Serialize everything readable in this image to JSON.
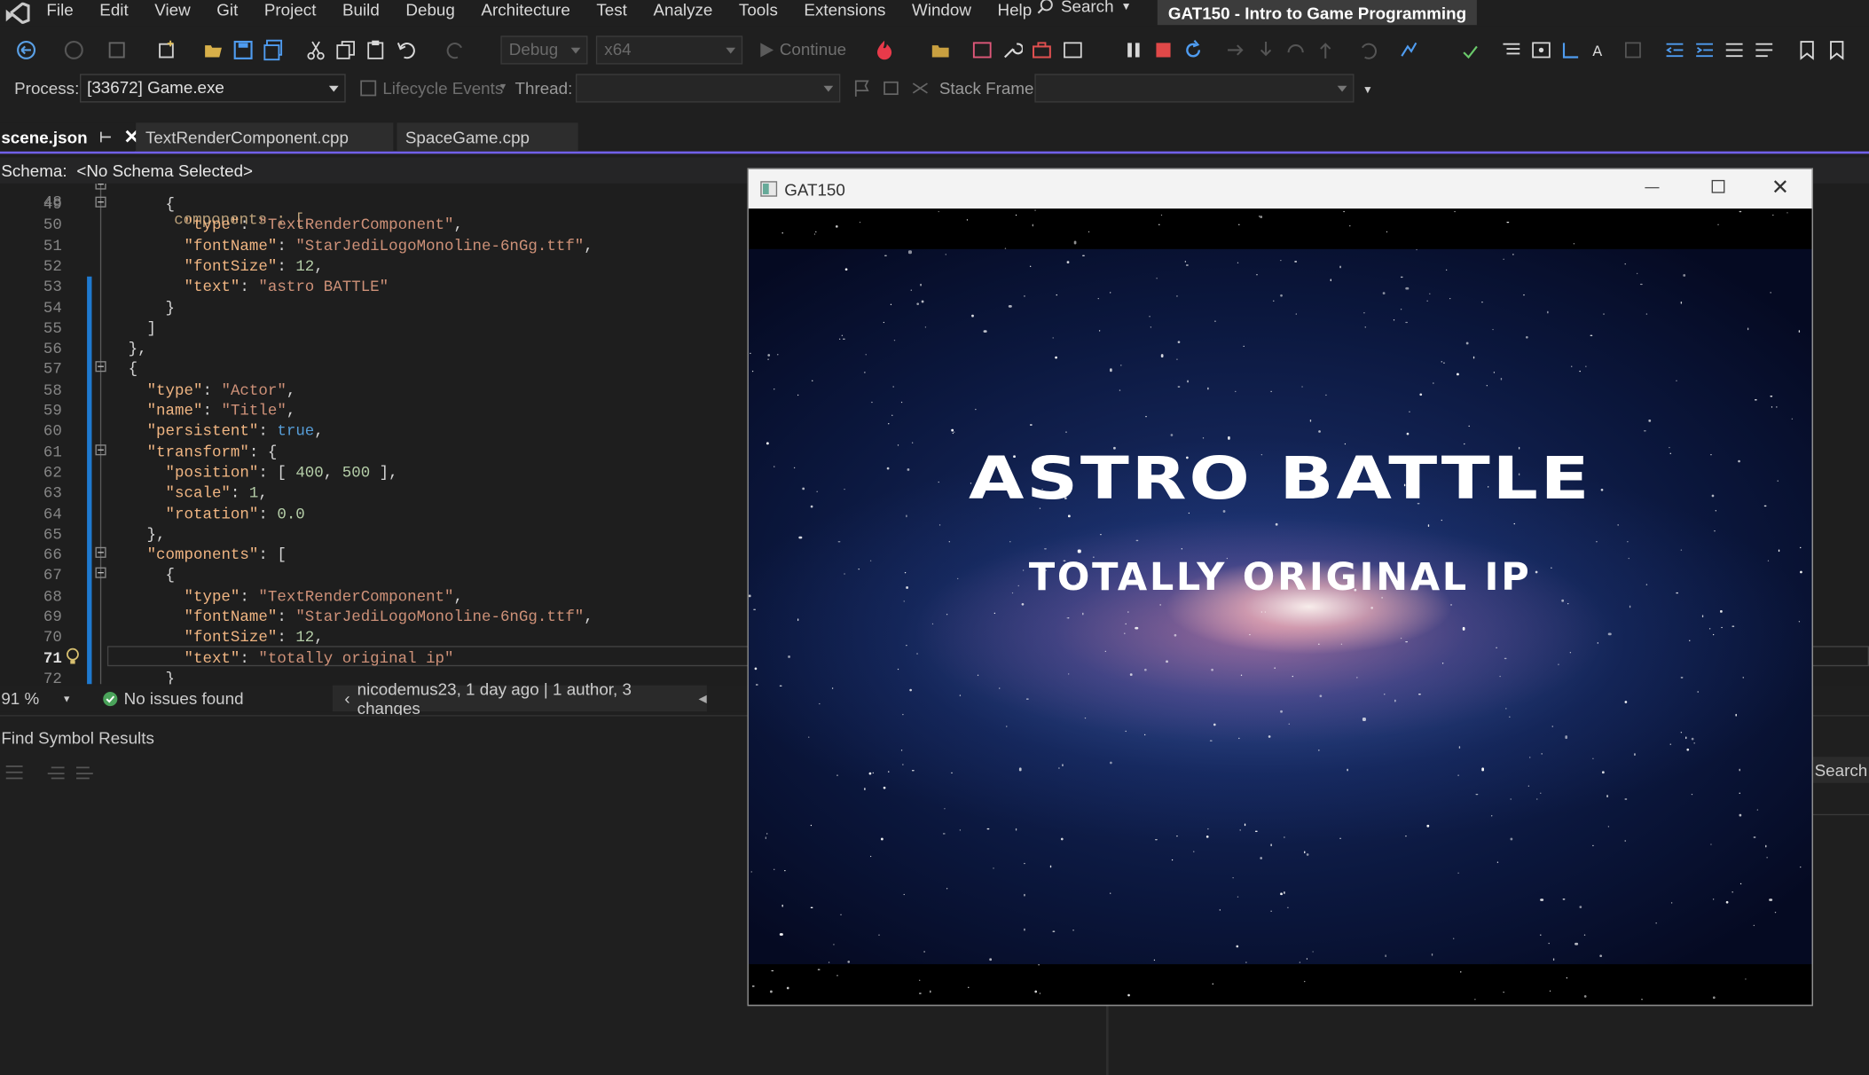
{
  "menu": {
    "items": [
      "File",
      "Edit",
      "View",
      "Git",
      "Project",
      "Build",
      "Debug",
      "Architecture",
      "Test",
      "Analyze",
      "Tools",
      "Extensions",
      "Window",
      "Help"
    ],
    "search_label": "Search",
    "solution_title": "GAT150 - Intro to Game Programming"
  },
  "toolbar": {
    "config": "Debug",
    "platform": "x64",
    "continue_label": "Continue"
  },
  "debug_bar": {
    "process_label": "Process:",
    "process_value": "[33672] Game.exe",
    "lifecycle_label": "Lifecycle Events",
    "thread_label": "Thread:",
    "stack_frame_label": "Stack Frame:"
  },
  "tabs": [
    {
      "label": "scene.json"
    },
    {
      "label": "TextRenderComponent.cpp"
    },
    {
      "label": "SpaceGame.cpp"
    }
  ],
  "schema": {
    "label": "Schema:",
    "value": "<No Schema Selected>"
  },
  "editor": {
    "top_fragment": "components : [",
    "lines": [
      {
        "num": "49",
        "code": "      {"
      },
      {
        "num": "50",
        "code": "        \"type\": \"TextRenderComponent\","
      },
      {
        "num": "51",
        "code": "        \"fontName\": \"StarJediLogoMonoline-6nGg.ttf\","
      },
      {
        "num": "52",
        "code": "        \"fontSize\": 12,"
      },
      {
        "num": "53",
        "code": "        \"text\": \"astro BATTLE\""
      },
      {
        "num": "54",
        "code": "      }"
      },
      {
        "num": "55",
        "code": "    ]"
      },
      {
        "num": "56",
        "code": "  },"
      },
      {
        "num": "57",
        "code": "  {"
      },
      {
        "num": "58",
        "code": "    \"type\": \"Actor\","
      },
      {
        "num": "59",
        "code": "    \"name\": \"Title\","
      },
      {
        "num": "60",
        "code": "    \"persistent\": true,"
      },
      {
        "num": "61",
        "code": "    \"transform\": {"
      },
      {
        "num": "62",
        "code": "      \"position\": [ 400, 500 ],"
      },
      {
        "num": "63",
        "code": "      \"scale\": 1,"
      },
      {
        "num": "64",
        "code": "      \"rotation\": 0.0"
      },
      {
        "num": "65",
        "code": "    },"
      },
      {
        "num": "66",
        "code": "    \"components\": ["
      },
      {
        "num": "67",
        "code": "      {"
      },
      {
        "num": "68",
        "code": "        \"type\": \"TextRenderComponent\","
      },
      {
        "num": "69",
        "code": "        \"fontName\": \"StarJediLogoMonoline-6nGg.ttf\","
      },
      {
        "num": "70",
        "code": "        \"fontSize\": 12,"
      },
      {
        "num": "71",
        "code": "        \"text\": \"totally original ip\""
      },
      {
        "num": "72",
        "code": "      }"
      }
    ],
    "current_line": "71"
  },
  "status": {
    "zoom": "91 %",
    "issues": "No issues found",
    "git_info": "nicodemus23, 1 day ago | 1 author, 3 changes"
  },
  "find_panel": {
    "title": "Find Symbol Results",
    "search_button": "Search"
  },
  "game_window": {
    "title": "GAT150",
    "heading": "ASTRO BATTLE",
    "subheading": "TOTALLY ORIGINAL IP"
  }
}
